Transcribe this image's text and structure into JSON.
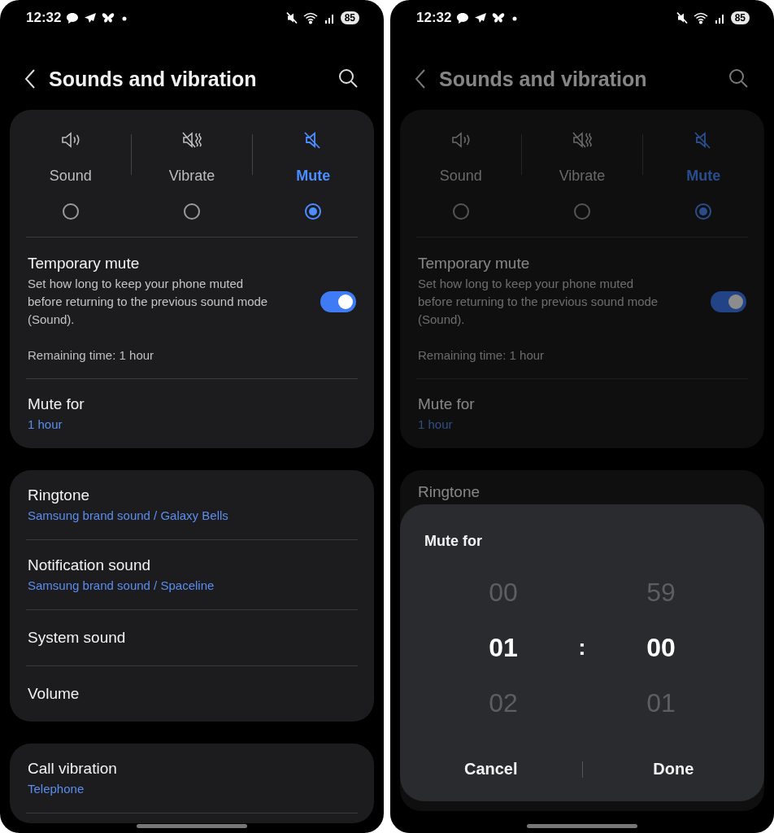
{
  "screens": [
    {
      "status_bar": {
        "time": "12:32",
        "battery": "85"
      },
      "title": "Sounds and vibration",
      "dimmed": false,
      "sound_modes": [
        {
          "label": "Sound",
          "kind": "sound",
          "selected": false
        },
        {
          "label": "Vibrate",
          "kind": "vibrate",
          "selected": false
        },
        {
          "label": "Mute",
          "kind": "mute",
          "selected": true
        }
      ],
      "temporary_mute": {
        "title": "Temporary mute",
        "description": "Set how long to keep your phone muted before returning to the previous sound mode (Sound).",
        "on": true,
        "remaining": "Remaining time: 1 hour"
      },
      "mute_for": {
        "title": "Mute for",
        "value": "1 hour"
      },
      "sound_settings": [
        {
          "title": "Ringtone",
          "value": "Samsung brand sound / Galaxy Bells"
        },
        {
          "title": "Notification sound",
          "value": "Samsung brand sound / Spaceline"
        },
        {
          "title": "System sound"
        },
        {
          "title": "Volume"
        }
      ],
      "vibration_settings": [
        {
          "title": "Call vibration",
          "value": "Telephone"
        }
      ]
    },
    {
      "status_bar": {
        "time": "12:32",
        "battery": "85"
      },
      "title": "Sounds and vibration",
      "dimmed": true,
      "sound_modes": [
        {
          "label": "Sound",
          "kind": "sound",
          "selected": false
        },
        {
          "label": "Vibrate",
          "kind": "vibrate",
          "selected": false
        },
        {
          "label": "Mute",
          "kind": "mute",
          "selected": true
        }
      ],
      "temporary_mute": {
        "title": "Temporary mute",
        "description": "Set how long to keep your phone muted before returning to the previous sound mode (Sound).",
        "on": true,
        "remaining": "Remaining time: 1 hour"
      },
      "mute_for": {
        "title": "Mute for",
        "value": "1 hour"
      },
      "sound_settings": [
        {
          "title": "Ringtone"
        }
      ],
      "dialog": {
        "title": "Mute for",
        "hours": [
          {
            "value": "00",
            "selected": false
          },
          {
            "value": "01",
            "selected": true
          },
          {
            "value": "02",
            "selected": false
          }
        ],
        "separator": ":",
        "minutes": [
          {
            "value": "59",
            "selected": false
          },
          {
            "value": "00",
            "selected": true
          },
          {
            "value": "01",
            "selected": false
          }
        ],
        "buttons": [
          "Cancel",
          "Done"
        ]
      }
    }
  ]
}
